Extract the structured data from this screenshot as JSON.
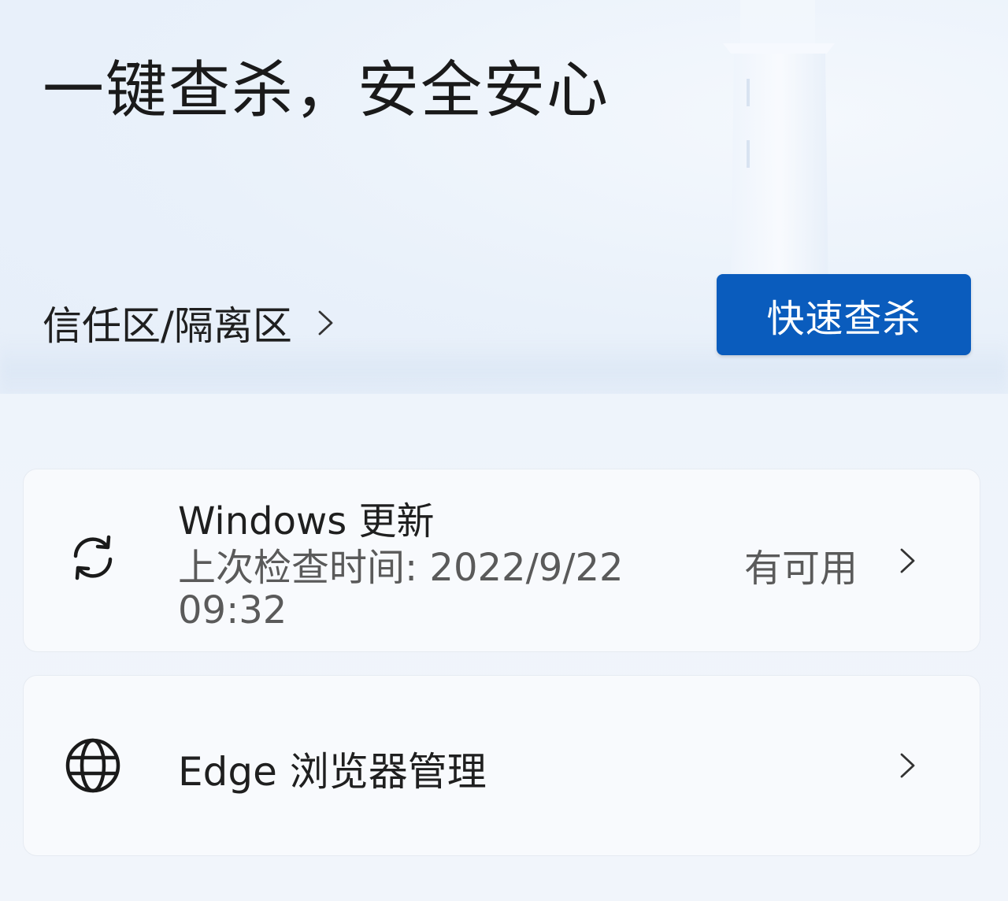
{
  "hero": {
    "title": "一键查杀，安全安心",
    "trust_link_label": "信任区/隔离区",
    "scan_button_label": "快速查杀"
  },
  "cards": {
    "windows_update": {
      "icon": "sync-icon",
      "title": "Windows 更新",
      "subtitle": "上次检查时间: 2022/9/22 09:32",
      "status": "有可用"
    },
    "edge": {
      "icon": "globe-icon",
      "title": "Edge 浏览器管理"
    }
  },
  "colors": {
    "accent": "#0a5cbd",
    "background": "#eef4fb",
    "card": "#f8fafd"
  }
}
